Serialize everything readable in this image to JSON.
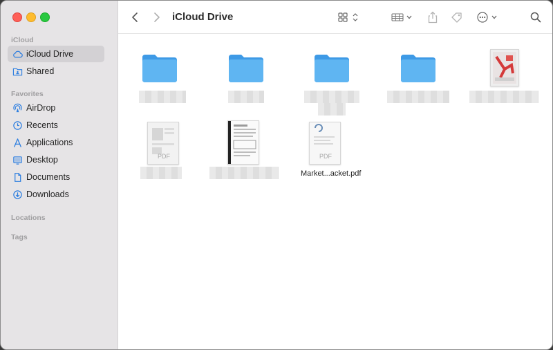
{
  "window": {
    "title": "iCloud Drive"
  },
  "sidebar": {
    "sections": {
      "icloud": "iCloud",
      "favorites": "Favorites",
      "locations": "Locations",
      "tags": "Tags"
    },
    "icloud_items": [
      {
        "label": "iCloud Drive",
        "icon": "cloud-icon",
        "selected": true
      },
      {
        "label": "Shared",
        "icon": "shared-folder-icon"
      }
    ],
    "favorite_items": [
      {
        "label": "AirDrop",
        "icon": "airdrop-icon"
      },
      {
        "label": "Recents",
        "icon": "clock-icon"
      },
      {
        "label": "Applications",
        "icon": "applications-icon"
      },
      {
        "label": "Desktop",
        "icon": "desktop-icon"
      },
      {
        "label": "Documents",
        "icon": "document-icon"
      },
      {
        "label": "Downloads",
        "icon": "download-icon"
      }
    ]
  },
  "toolbar": {
    "buttons": [
      "back-icon",
      "forward-icon",
      "grid-view-icon",
      "group-icon",
      "share-icon",
      "tag-icon",
      "more-icon",
      "search-icon"
    ]
  },
  "files": [
    {
      "type": "folder",
      "name": ""
    },
    {
      "type": "folder",
      "name": ""
    },
    {
      "type": "folder",
      "name": ""
    },
    {
      "type": "folder",
      "name": ""
    },
    {
      "type": "image",
      "name": ""
    },
    {
      "type": "pdf",
      "name": "",
      "badge": "PDF"
    },
    {
      "type": "document-scan",
      "name": ""
    },
    {
      "type": "pdf",
      "name": "Market...acket.pdf",
      "badge": "PDF"
    }
  ],
  "colors": {
    "accent": "#2b7de0",
    "folder": "#5fb5f2",
    "folder_tab": "#3e9ae6",
    "sidebar_bg": "#e6e4e6",
    "sidebar_selected": "#d3d1d4"
  }
}
